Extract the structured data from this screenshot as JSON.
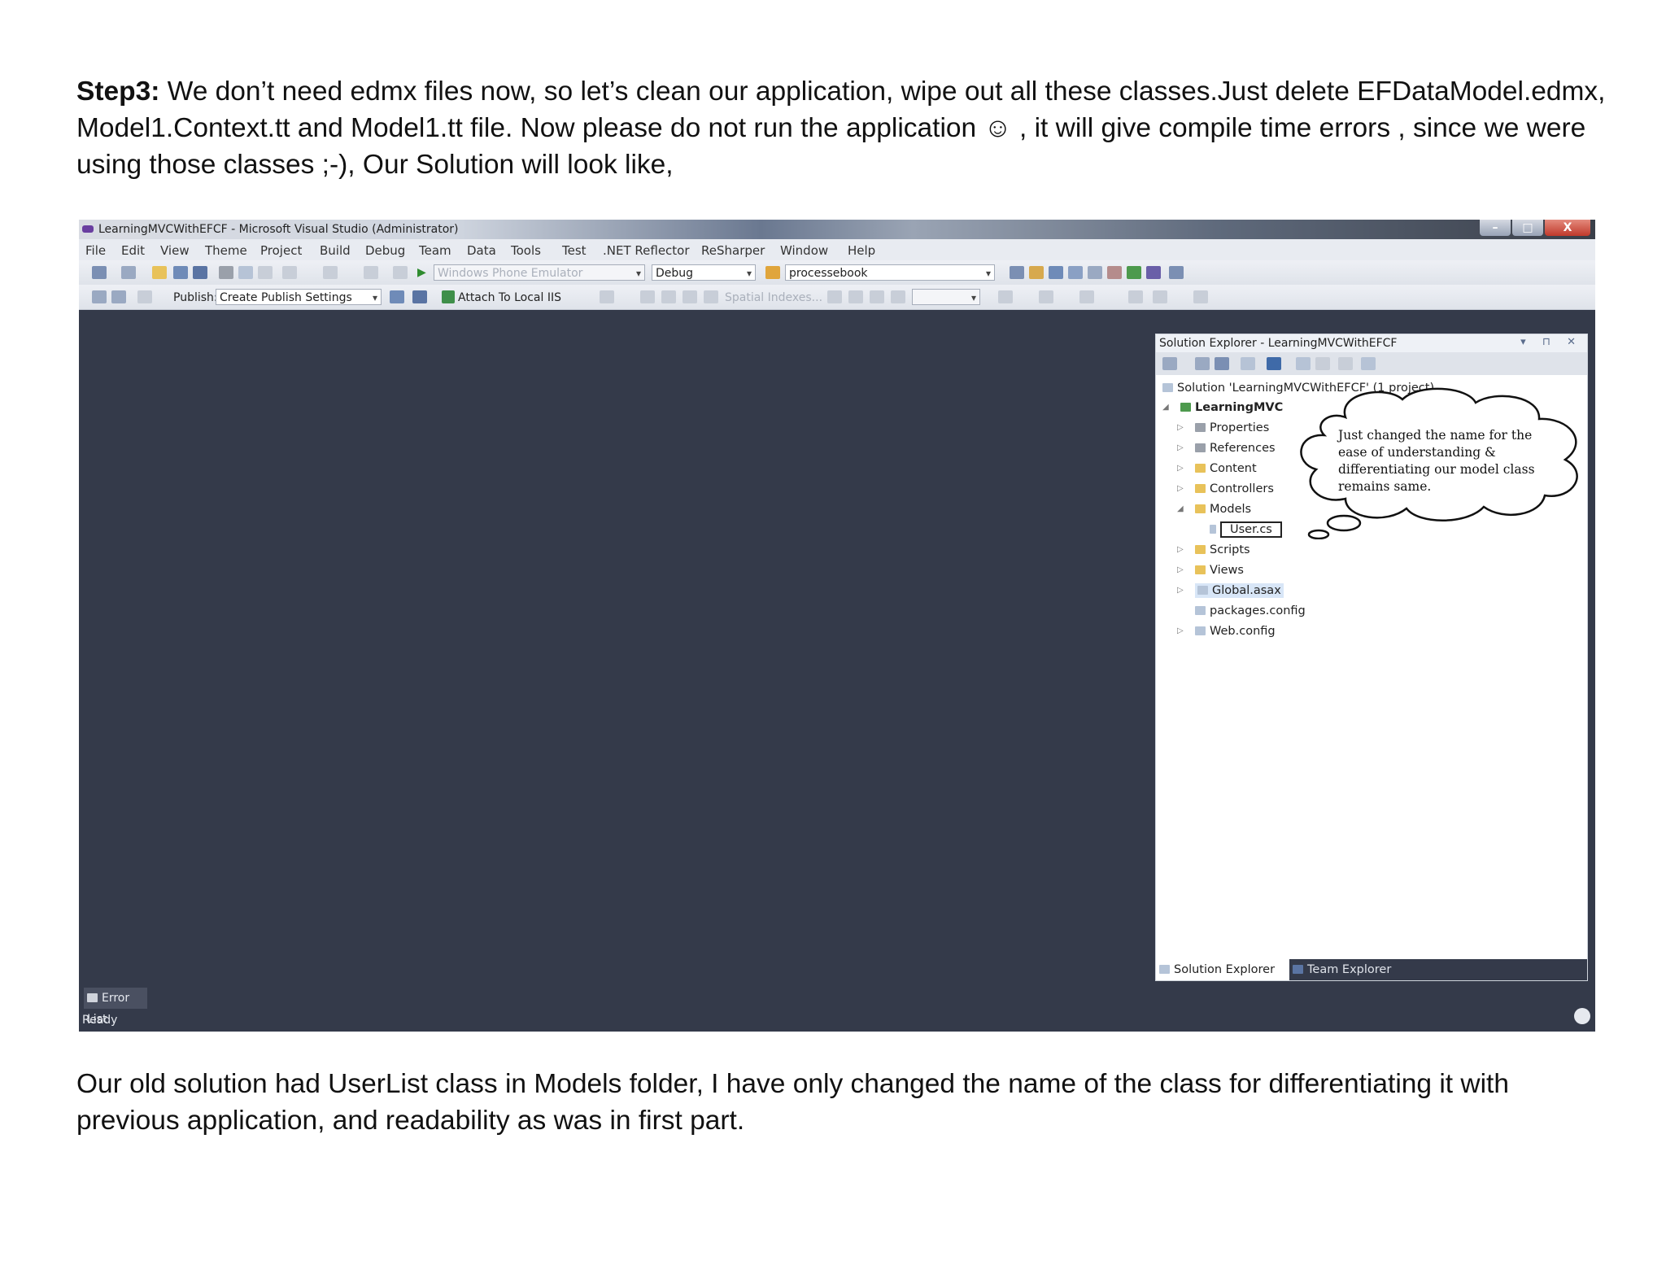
{
  "doc": {
    "step_label": "Step3:",
    "intro_text": "We don’t need edmx files now, so let’s clean our application, wipe out all these classes.Just delete EFDataModel.edmx, Model1.Context.tt and Model1.tt file. Now please do not run the application ☺ , it will give compile time errors , since we were using those classes ;-), Our Solution will look like,",
    "outro_text": "Our old solution had UserList class in Models folder, I have only changed the name of the class for differentiating it with previous application, and readability as was in first part."
  },
  "vs": {
    "window_title": "LearningMVCWithEFCF - Microsoft Visual Studio (Administrator)",
    "window_buttons": {
      "minimize": "–",
      "maximize": "□",
      "close": "X"
    },
    "menu": [
      "File",
      "Edit",
      "View",
      "Theme",
      "Project",
      "Build",
      "Debug",
      "Team",
      "Data",
      "Tools",
      "Test",
      ".NET Reflector",
      "ReSharper",
      "Window",
      "Help"
    ],
    "toolbar": {
      "emulator": "Windows Phone Emulator",
      "config": "Debug",
      "startup_project": "processebook",
      "publish_label": "Publish:",
      "publish_combo": "Create Publish Settings",
      "attach_iis": "Attach To Local IIS",
      "spatial": "Spatial Indexes..."
    },
    "solution_explorer": {
      "title": "Solution Explorer - LearningMVCWithEFCF",
      "header_controls": "▾ ⊓ ✕",
      "solution_node": "Solution 'LearningMVCWithEFCF' (1 project)",
      "project_node": "LearningMVC",
      "items": [
        "Properties",
        "References",
        "Content",
        "Controllers",
        "Models",
        "User.cs",
        "Scripts",
        "Views",
        "Global.asax",
        "packages.config",
        "Web.config"
      ],
      "tab_solution": "Solution Explorer",
      "tab_team": "Team Explorer"
    },
    "callout": "Just changed the name for the ease of understanding & differentiating our model class remains same.",
    "error_list": "Error List",
    "status": "Ready"
  }
}
